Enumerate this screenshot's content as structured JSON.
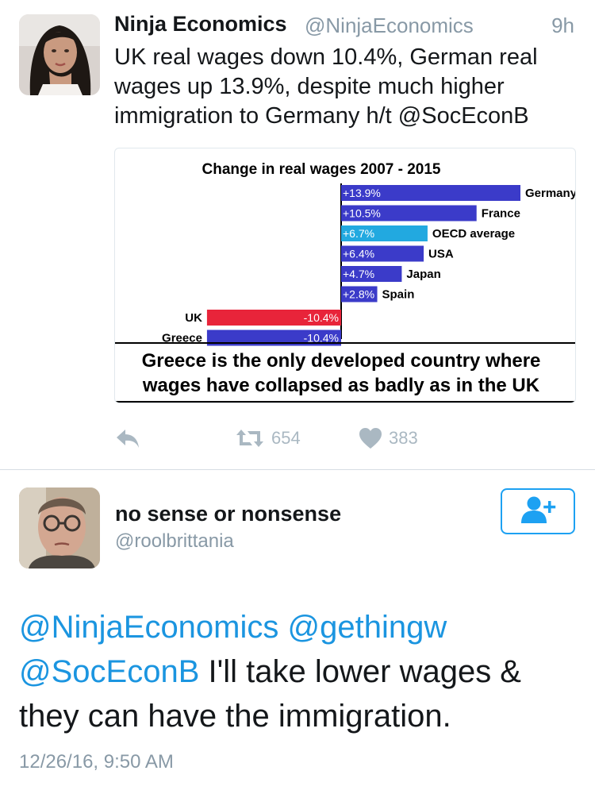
{
  "tweet1": {
    "display_name": "Ninja Economics",
    "handle": "@NinjaEconomics",
    "time": "9h",
    "text": "UK real wages down 10.4%, German real wages up 13.9%, despite much higher immigration to Germany h/t @SocEconB",
    "retweet_count": "654",
    "like_count": "383"
  },
  "chart_data": {
    "type": "bar",
    "orientation": "horizontal",
    "title": "Change in real wages 2007 - 2015",
    "categories": [
      "Germany",
      "France",
      "OECD average",
      "USA",
      "Japan",
      "Spain",
      "UK",
      "Greece"
    ],
    "values": [
      13.9,
      10.5,
      6.7,
      6.4,
      4.7,
      2.8,
      -10.4,
      -10.4
    ],
    "value_labels": [
      "+13.9%",
      "+10.5%",
      "+6.7%",
      "+6.4%",
      "+4.7%",
      "+2.8%",
      "-10.4%",
      "-10.4%"
    ],
    "bar_colors": [
      "#3b3bc9",
      "#3b3bc9",
      "#22a9e0",
      "#3b3bc9",
      "#3b3bc9",
      "#3b3bc9",
      "#e8243a",
      "#3b3bc9"
    ],
    "caption": "Greece is the only developed country where wages have collapsed as badly as in the UK",
    "xlim": [
      -10.4,
      13.9
    ],
    "grid": false,
    "legend": false
  },
  "tweet2": {
    "display_name": "no sense or nonsense",
    "handle": "@roolbrittania",
    "mentions": [
      "@NinjaEconomics",
      "@gethingw",
      "@SocEconB"
    ],
    "body": "I'll take lower wages & they can have the immigration.",
    "timestamp": "12/26/16, 9:50 AM"
  },
  "icons": {
    "reply": "reply-icon",
    "retweet": "retweet-icon",
    "like": "heart-icon",
    "follow": "follow-user-icon"
  },
  "colors": {
    "link": "#1b95e0",
    "muted": "#8899a6",
    "action_grey": "#aab8c2",
    "follow_blue": "#1da1f2"
  }
}
